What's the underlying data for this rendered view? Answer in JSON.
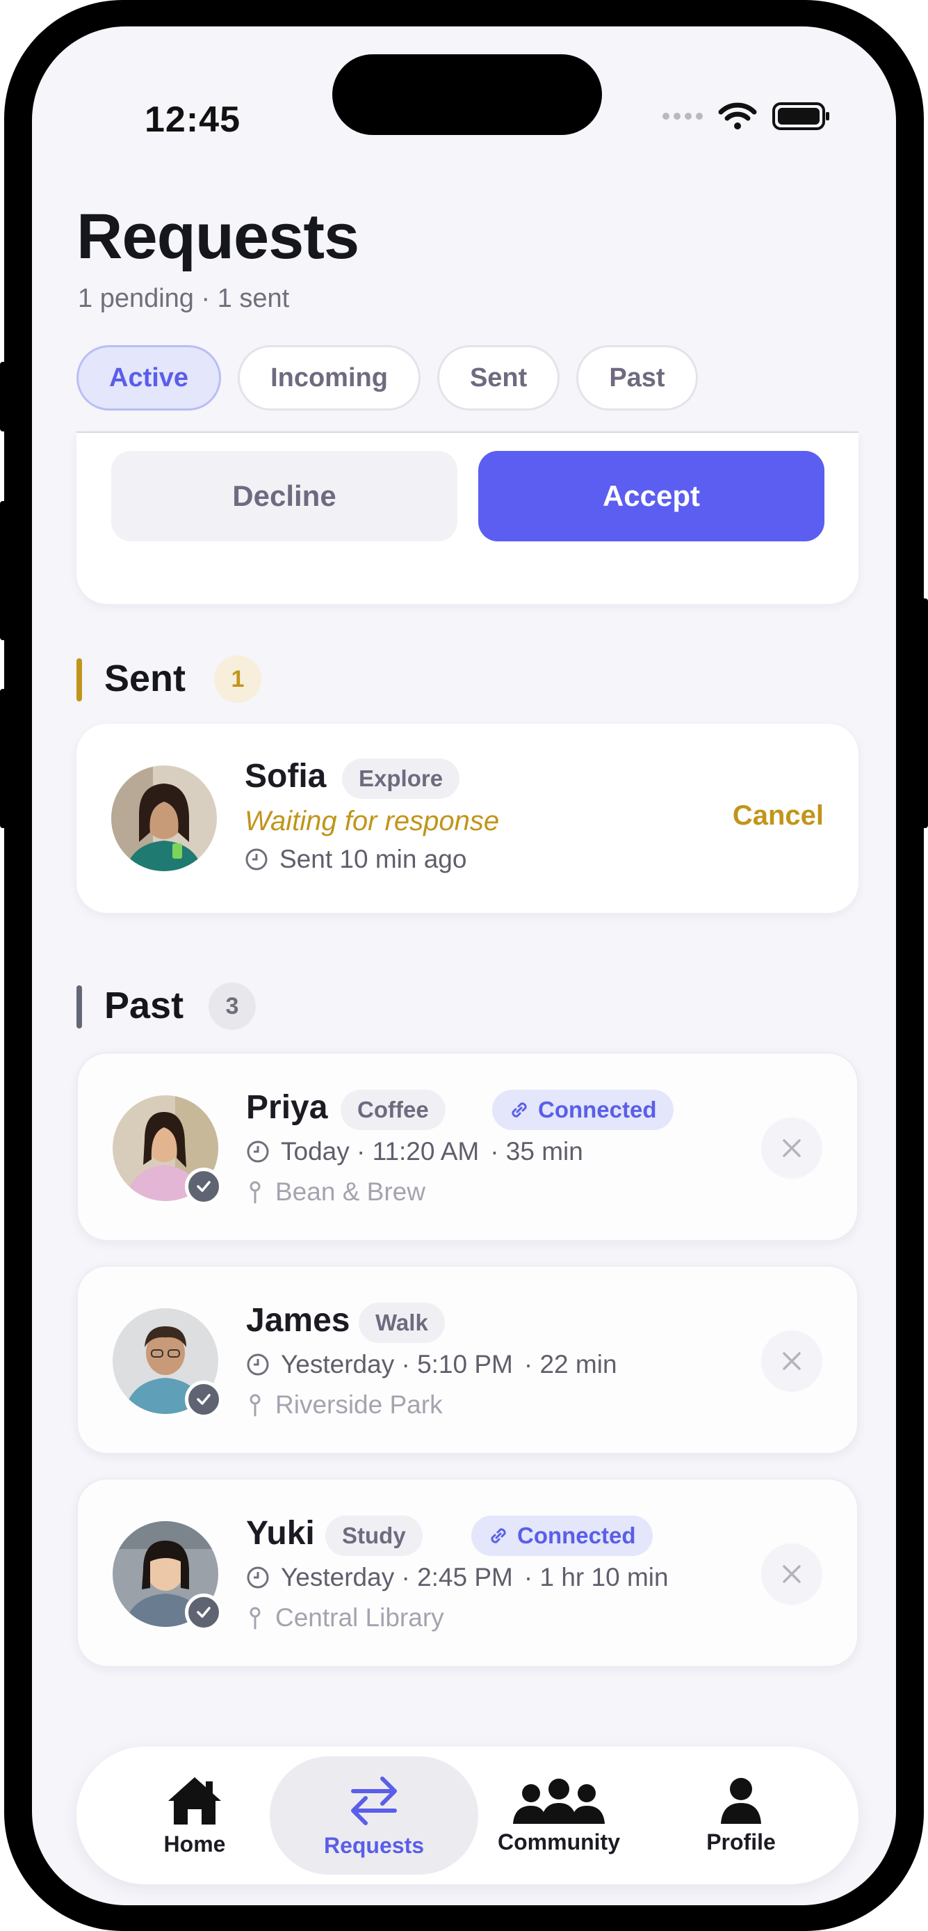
{
  "status_bar": {
    "time": "12:45"
  },
  "header": {
    "title": "Requests",
    "subtitle": "1 pending · 1 sent"
  },
  "filters": [
    {
      "label": "Active",
      "active": true
    },
    {
      "label": "Incoming",
      "active": false
    },
    {
      "label": "Sent",
      "active": false
    },
    {
      "label": "Past",
      "active": false
    }
  ],
  "incoming_actions": {
    "decline": "Decline",
    "accept": "Accept"
  },
  "sent_section": {
    "title": "Sent",
    "count": "1",
    "accent": "#c1951b",
    "item": {
      "name": "Sofia",
      "tag": "Explore",
      "status": "Waiting for response",
      "time": "Sent 10 min ago",
      "action": "Cancel"
    }
  },
  "past_section": {
    "title": "Past",
    "count": "3",
    "accent": "#646876",
    "items": [
      {
        "name": "Priya",
        "tag": "Coffee",
        "badge": "Connected",
        "when": "Today · 11:20 AM",
        "duration": "· 35 min",
        "place": "Bean & Brew"
      },
      {
        "name": "James",
        "tag": "Walk",
        "badge": "",
        "when": "Yesterday · 5:10 PM",
        "duration": "· 22 min",
        "place": "Riverside Park"
      },
      {
        "name": "Yuki",
        "tag": "Study",
        "badge": "Connected",
        "when": "Yesterday · 2:45 PM",
        "duration": "· 1 hr 10 min",
        "place": "Central Library"
      }
    ]
  },
  "tabbar": [
    {
      "label": "Home",
      "icon": "home-icon",
      "active": false
    },
    {
      "label": "Requests",
      "icon": "swap-arrows-icon",
      "active": true
    },
    {
      "label": "Community",
      "icon": "group-icon",
      "active": false
    },
    {
      "label": "Profile",
      "icon": "person-icon",
      "active": false
    }
  ],
  "colors": {
    "accent": "#5b5ef0",
    "sent_accent": "#c1951b",
    "background": "#f5f5fa"
  }
}
